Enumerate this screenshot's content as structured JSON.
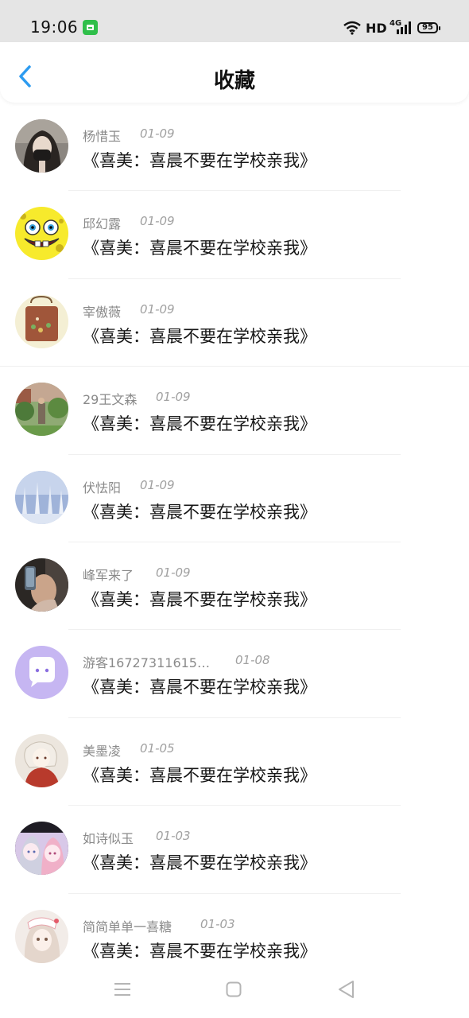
{
  "status_bar": {
    "time": "19:06",
    "network_label": "HD",
    "network_type": "4G",
    "battery": "95",
    "accent_color": "#2fbf4a"
  },
  "header": {
    "title": "收藏",
    "back_icon": "chevron-left-icon",
    "back_color": "#2d9bf0"
  },
  "items": [
    {
      "username": "杨惜玉",
      "date": "01-09",
      "title": "《喜美：喜晨不要在学校亲我》",
      "avatar": "avatar-girl-mask"
    },
    {
      "username": "邱幻露",
      "date": "01-09",
      "title": "《喜美：喜晨不要在学校亲我》",
      "avatar": "avatar-sponge-cartoon"
    },
    {
      "username": "宰傲薇",
      "date": "01-09",
      "title": "《喜美：喜晨不要在学校亲我》",
      "avatar": "avatar-tote-bag"
    },
    {
      "username": "29王文森",
      "date": "01-09",
      "title": "《喜美：喜晨不要在学校亲我》",
      "avatar": "avatar-park-photo"
    },
    {
      "username": "伏怯阳",
      "date": "01-09",
      "title": "《喜美：喜晨不要在学校亲我》",
      "avatar": "avatar-snow-trees"
    },
    {
      "username": "峰军来了",
      "date": "01-09",
      "title": "《喜美：喜晨不要在学校亲我》",
      "avatar": "avatar-selfie"
    },
    {
      "username": "游客16727311615…",
      "date": "01-08",
      "title": "《喜美：喜晨不要在学校亲我》",
      "avatar": "avatar-chat-bubble"
    },
    {
      "username": "美墨凌",
      "date": "01-05",
      "title": "《喜美：喜晨不要在学校亲我》",
      "avatar": "avatar-anime-red"
    },
    {
      "username": "如诗似玉",
      "date": "01-03",
      "title": "《喜美：喜晨不要在学校亲我》",
      "avatar": "avatar-anime-two-girls"
    },
    {
      "username": "简简单单一喜糖",
      "date": "01-03",
      "title": "《喜美：喜晨不要在学校亲我》",
      "avatar": "avatar-anime-girl"
    }
  ],
  "nav_bar": {
    "menu_icon": "menu-icon",
    "home_icon": "home-square-icon",
    "back_icon": "back-triangle-icon"
  }
}
